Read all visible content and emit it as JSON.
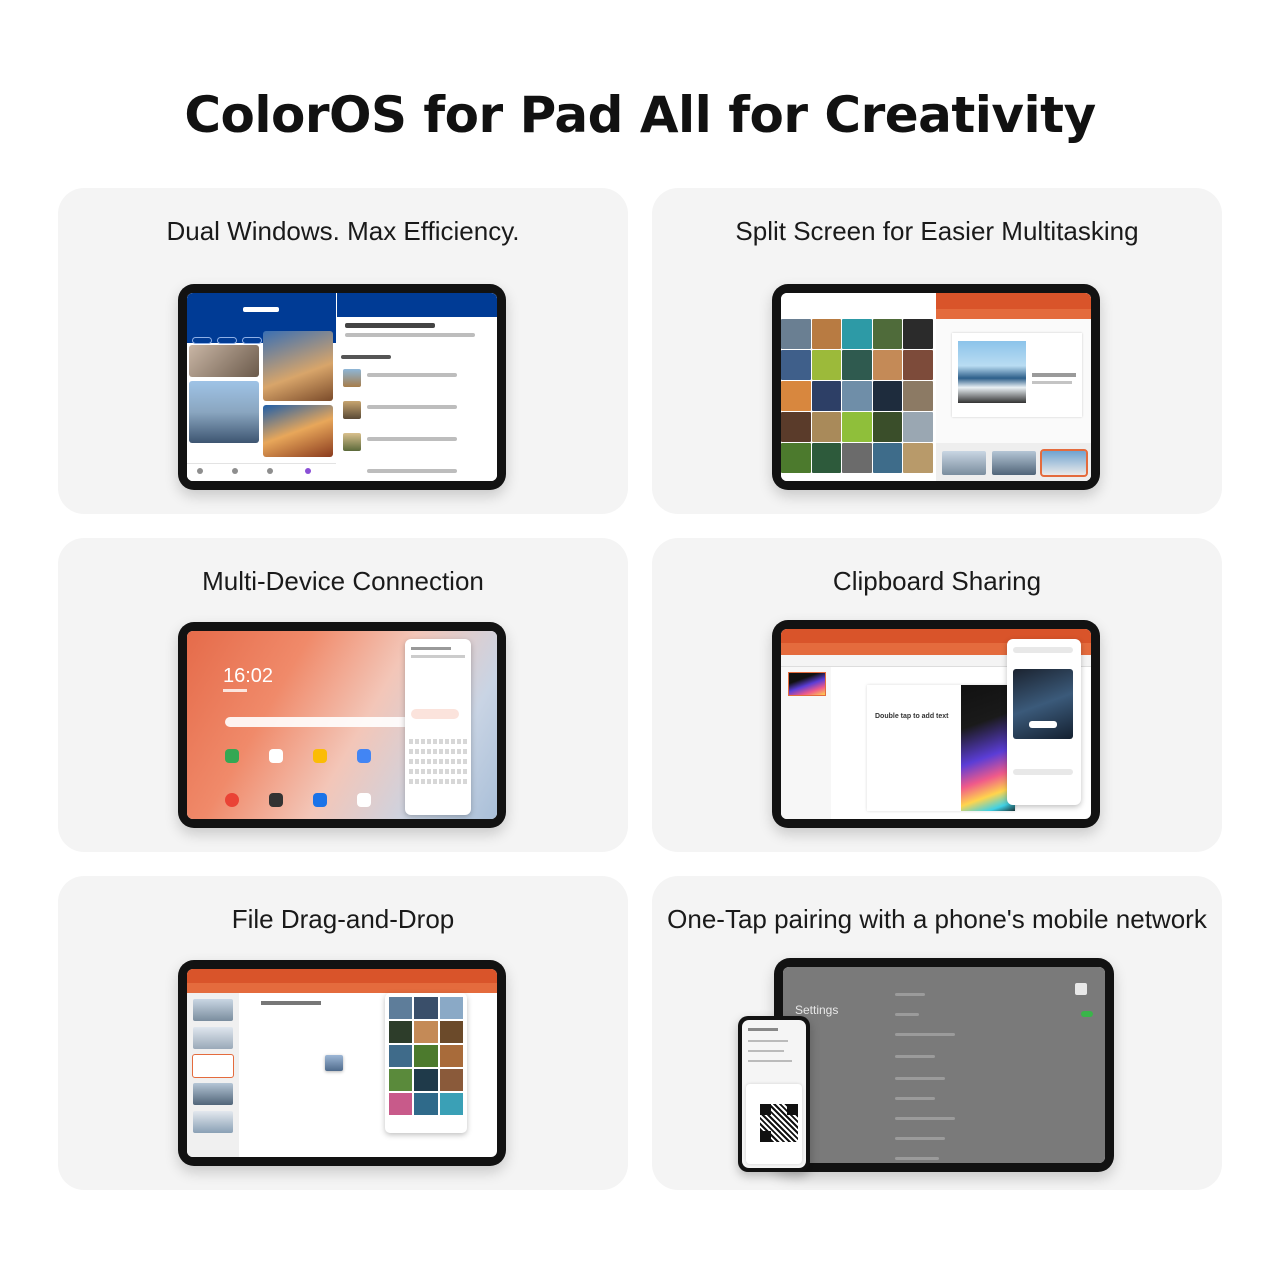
{
  "title": "ColorOS for Pad All for Creativity",
  "cards": [
    {
      "title": "Dual Windows. Max Efficiency."
    },
    {
      "title": "Split Screen for Easier Multitasking"
    },
    {
      "title": "Multi-Device Connection"
    },
    {
      "title": "Clipboard Sharing"
    },
    {
      "title": "File Drag-and-Drop"
    },
    {
      "title": "One-Tap pairing with a phone's mobile network"
    }
  ],
  "screens": {
    "multi_device_clock": "16:02",
    "clipboard_slide_text": "Double tap to add text",
    "pairing_settings_label": "Settings"
  },
  "colors": {
    "card_bg": "#f4f4f4",
    "booking_blue": "#003b95",
    "office_orange": "#d9542a"
  }
}
